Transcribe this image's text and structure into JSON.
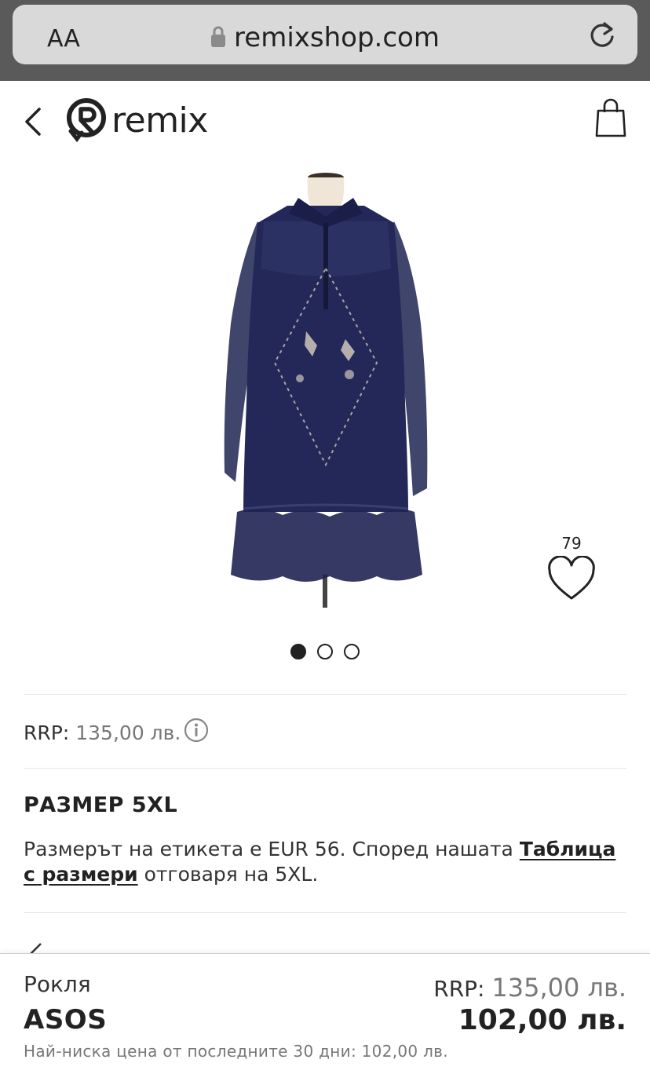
{
  "browser": {
    "text_size_label": "AA",
    "url": "remixshop.com"
  },
  "header": {
    "logo_text": "remix"
  },
  "product": {
    "likes": "79",
    "image_count": 3,
    "active_image": 1,
    "rrp_label": "RRP:",
    "rrp_value": "135,00 лв.",
    "size_title": "РАЗМЕР 5XL",
    "size_desc_before": "Размерът на етикета е EUR 56. Според нашата ",
    "size_chart_link": "Таблица с размери",
    "size_desc_after": " отговаря на 5XL."
  },
  "bottom_bar": {
    "category": "Рокля",
    "brand": "ASOS",
    "rrp_label": "RRP:",
    "rrp_value": "135,00 лв.",
    "price": "102,00 лв.",
    "lowest_price_note": "Най-ниска цена от последните 30 дни: 102,00 лв."
  },
  "colors": {
    "dress_navy": "#1f2452",
    "text_dark": "#222222",
    "text_muted": "#777777",
    "browser_chrome": "#5a5a5a"
  }
}
